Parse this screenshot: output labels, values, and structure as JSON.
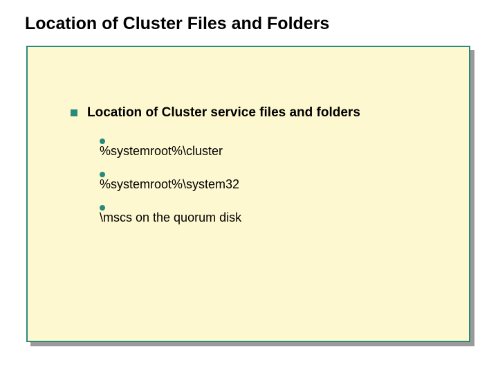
{
  "slide": {
    "title": "Location of Cluster Files and Folders",
    "section_heading": "Location of Cluster service files and folders",
    "items": [
      "%systemroot%\\cluster",
      "%systemroot%\\system32",
      "\\mscs on the quorum disk"
    ]
  }
}
